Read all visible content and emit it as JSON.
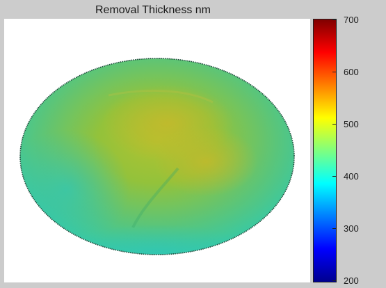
{
  "chart_data": {
    "type": "heatmap",
    "title": "Removal Thickness nm",
    "xlabel": "",
    "ylabel": "",
    "colormap": "jet",
    "clim": [
      200,
      700
    ],
    "colorbar_ticks": [
      700,
      600,
      500,
      400,
      300,
      200
    ],
    "colorbar_tick_labels": [
      "700",
      "600",
      "500",
      "400",
      "300",
      "200"
    ],
    "surface_shape": "ellipse",
    "regions": [
      {
        "name": "edge",
        "approx_value": 440
      },
      {
        "name": "outer ring",
        "approx_value": 455
      },
      {
        "name": "center",
        "approx_value": 500
      },
      {
        "name": "upper center",
        "approx_value": 510
      }
    ],
    "grid": false
  }
}
